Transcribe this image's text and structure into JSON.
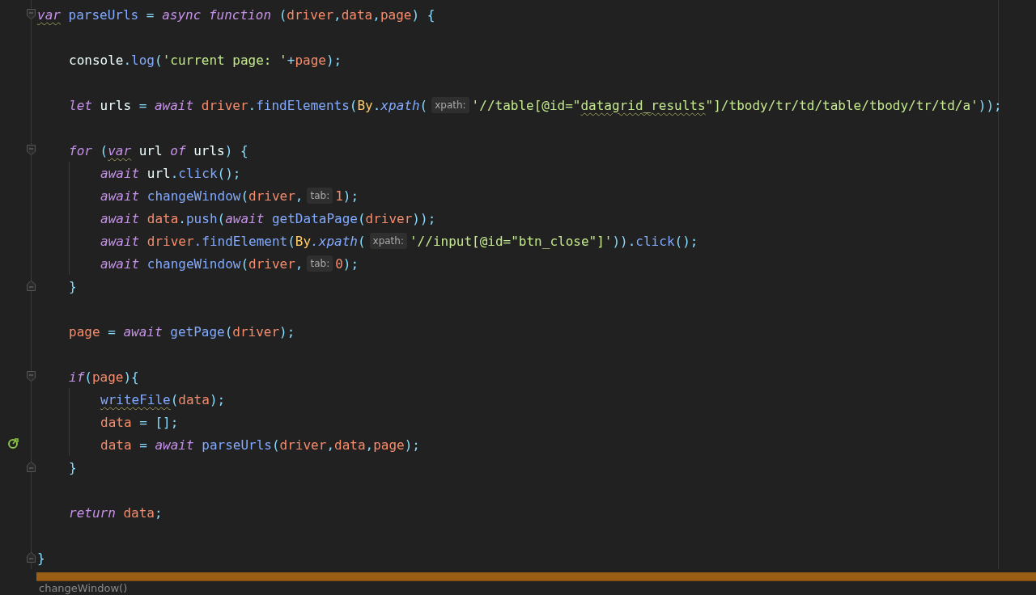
{
  "editor": {
    "lines": [
      {
        "kind": "code",
        "fold_start": true,
        "tokens": [
          {
            "kind": "kw",
            "text": "var",
            "warning": true
          },
          {
            "kind": "fn",
            "text": " parseUrls"
          },
          {
            "kind": "op",
            "text": " = "
          },
          {
            "kind": "kw",
            "text": "async"
          },
          {
            "kind": "kw",
            "text": " function"
          },
          {
            "kind": "op",
            "text": " ("
          },
          {
            "kind": "var",
            "text": "driver"
          },
          {
            "kind": "op",
            "text": ","
          },
          {
            "kind": "var",
            "text": "data"
          },
          {
            "kind": "op",
            "text": ","
          },
          {
            "kind": "var",
            "text": "page"
          },
          {
            "kind": "op",
            "text": ") {"
          }
        ],
        "children": [
          {
            "kind": "blank"
          },
          {
            "kind": "code",
            "tokens": [
              {
                "kind": "plain",
                "text": "console"
              },
              {
                "kind": "op",
                "text": "."
              },
              {
                "kind": "fn",
                "text": "log"
              },
              {
                "kind": "op",
                "text": "("
              },
              {
                "kind": "str",
                "text": "'current page: '"
              },
              {
                "kind": "op",
                "text": "+"
              },
              {
                "kind": "var",
                "text": "page"
              },
              {
                "kind": "op",
                "text": ");"
              }
            ]
          },
          {
            "kind": "blank"
          },
          {
            "kind": "code",
            "tokens": [
              {
                "kind": "kw",
                "text": "let"
              },
              {
                "kind": "plain",
                "text": " urls "
              },
              {
                "kind": "op",
                "text": "= "
              },
              {
                "kind": "kw",
                "text": "await"
              },
              {
                "kind": "var",
                "text": " driver"
              },
              {
                "kind": "op",
                "text": "."
              },
              {
                "kind": "fn",
                "text": "findElements"
              },
              {
                "kind": "op",
                "text": "("
              },
              {
                "kind": "cls",
                "text": "By"
              },
              {
                "kind": "op",
                "text": "."
              },
              {
                "kind": "method",
                "text": "xpath"
              },
              {
                "kind": "op",
                "text": "("
              },
              {
                "kind": "hint",
                "text": "xpath:"
              },
              {
                "kind": "str",
                "text": "'//table[@id=\""
              },
              {
                "kind": "str",
                "text": "datagrid_results",
                "warning": true
              },
              {
                "kind": "str",
                "text": "\"]/tbody/tr/td/table/tbody/tr/td/a'"
              },
              {
                "kind": "op",
                "text": "));"
              }
            ]
          },
          {
            "kind": "blank"
          },
          {
            "kind": "code",
            "fold_start": true,
            "tokens": [
              {
                "kind": "kw",
                "text": "for"
              },
              {
                "kind": "op",
                "text": " ("
              },
              {
                "kind": "kw",
                "text": "var",
                "warning": true
              },
              {
                "kind": "plain",
                "text": " url "
              },
              {
                "kind": "kw",
                "text": "of"
              },
              {
                "kind": "plain",
                "text": " urls"
              },
              {
                "kind": "op",
                "text": ") {"
              }
            ],
            "children": [
              {
                "kind": "code",
                "tokens": [
                  {
                    "kind": "kw",
                    "text": "await"
                  },
                  {
                    "kind": "plain",
                    "text": " url"
                  },
                  {
                    "kind": "op",
                    "text": "."
                  },
                  {
                    "kind": "fn",
                    "text": "click"
                  },
                  {
                    "kind": "op",
                    "text": "();"
                  }
                ]
              },
              {
                "kind": "code",
                "tokens": [
                  {
                    "kind": "kw",
                    "text": "await"
                  },
                  {
                    "kind": "fn",
                    "text": " changeWindow"
                  },
                  {
                    "kind": "op",
                    "text": "("
                  },
                  {
                    "kind": "var",
                    "text": "driver"
                  },
                  {
                    "kind": "op",
                    "text": ","
                  },
                  {
                    "kind": "hint",
                    "text": "tab:"
                  },
                  {
                    "kind": "num",
                    "text": "1"
                  },
                  {
                    "kind": "op",
                    "text": ");"
                  }
                ]
              },
              {
                "kind": "code",
                "tokens": [
                  {
                    "kind": "kw",
                    "text": "await"
                  },
                  {
                    "kind": "var",
                    "text": " data"
                  },
                  {
                    "kind": "op",
                    "text": "."
                  },
                  {
                    "kind": "fn",
                    "text": "push"
                  },
                  {
                    "kind": "op",
                    "text": "("
                  },
                  {
                    "kind": "kw",
                    "text": "await"
                  },
                  {
                    "kind": "fn",
                    "text": " getDataPage"
                  },
                  {
                    "kind": "op",
                    "text": "("
                  },
                  {
                    "kind": "var",
                    "text": "driver"
                  },
                  {
                    "kind": "op",
                    "text": "));"
                  }
                ]
              },
              {
                "kind": "code",
                "tokens": [
                  {
                    "kind": "kw",
                    "text": "await"
                  },
                  {
                    "kind": "var",
                    "text": " driver"
                  },
                  {
                    "kind": "fn",
                    "text": ".findElement"
                  },
                  {
                    "kind": "op",
                    "text": "("
                  },
                  {
                    "kind": "cls",
                    "text": "By"
                  },
                  {
                    "kind": "method",
                    "text": ".xpath"
                  },
                  {
                    "kind": "op",
                    "text": "("
                  },
                  {
                    "kind": "hint",
                    "text": "xpath:"
                  },
                  {
                    "kind": "str",
                    "text": "'//input[@id=\"btn_close\"]'"
                  },
                  {
                    "kind": "op",
                    "text": "))."
                  },
                  {
                    "kind": "fn",
                    "text": "click"
                  },
                  {
                    "kind": "op",
                    "text": "();"
                  }
                ]
              },
              {
                "kind": "code",
                "tokens": [
                  {
                    "kind": "kw",
                    "text": "await"
                  },
                  {
                    "kind": "fn",
                    "text": " changeWindow"
                  },
                  {
                    "kind": "op",
                    "text": "("
                  },
                  {
                    "kind": "var",
                    "text": "driver"
                  },
                  {
                    "kind": "op",
                    "text": ","
                  },
                  {
                    "kind": "hint",
                    "text": "tab:"
                  },
                  {
                    "kind": "num",
                    "text": "0"
                  },
                  {
                    "kind": "op",
                    "text": ");"
                  }
                ]
              }
            ]
          },
          {
            "kind": "code",
            "fold_end": true,
            "tokens": [
              {
                "kind": "op",
                "text": "}"
              }
            ]
          },
          {
            "kind": "blank"
          },
          {
            "kind": "code",
            "tokens": [
              {
                "kind": "var",
                "text": "page"
              },
              {
                "kind": "op",
                "text": " = "
              },
              {
                "kind": "kw",
                "text": "await"
              },
              {
                "kind": "fn",
                "text": " getPage"
              },
              {
                "kind": "op",
                "text": "("
              },
              {
                "kind": "var",
                "text": "driver"
              },
              {
                "kind": "op",
                "text": ");"
              }
            ]
          },
          {
            "kind": "blank"
          },
          {
            "kind": "code",
            "fold_start": true,
            "tokens": [
              {
                "kind": "kw",
                "text": "if"
              },
              {
                "kind": "op",
                "text": "("
              },
              {
                "kind": "var",
                "text": "page"
              },
              {
                "kind": "op",
                "text": "){"
              }
            ],
            "children": [
              {
                "kind": "code",
                "tokens": [
                  {
                    "kind": "fn",
                    "text": "writeFile",
                    "warning": true
                  },
                  {
                    "kind": "op",
                    "text": "("
                  },
                  {
                    "kind": "var",
                    "text": "data"
                  },
                  {
                    "kind": "op",
                    "text": ");"
                  }
                ]
              },
              {
                "kind": "code",
                "tokens": [
                  {
                    "kind": "var",
                    "text": "data"
                  },
                  {
                    "kind": "op",
                    "text": " = [];"
                  }
                ]
              },
              {
                "kind": "code",
                "recursive_call": true,
                "tokens": [
                  {
                    "kind": "var",
                    "text": "data"
                  },
                  {
                    "kind": "op",
                    "text": " = "
                  },
                  {
                    "kind": "kw",
                    "text": "await"
                  },
                  {
                    "kind": "fn",
                    "text": " parseUrls"
                  },
                  {
                    "kind": "op",
                    "text": "("
                  },
                  {
                    "kind": "var",
                    "text": "driver"
                  },
                  {
                    "kind": "op",
                    "text": ","
                  },
                  {
                    "kind": "var",
                    "text": "data"
                  },
                  {
                    "kind": "op",
                    "text": ","
                  },
                  {
                    "kind": "var",
                    "text": "page"
                  },
                  {
                    "kind": "op",
                    "text": ");"
                  }
                ]
              }
            ]
          },
          {
            "kind": "code",
            "fold_end": true,
            "tokens": [
              {
                "kind": "op",
                "text": "}"
              }
            ]
          },
          {
            "kind": "blank"
          },
          {
            "kind": "code",
            "tokens": [
              {
                "kind": "kw",
                "text": "return"
              },
              {
                "kind": "var",
                "text": " data"
              },
              {
                "kind": "op",
                "text": ";"
              }
            ]
          },
          {
            "kind": "blank"
          }
        ]
      },
      {
        "kind": "code",
        "fold_end": true,
        "tokens": [
          {
            "kind": "op",
            "text": "}"
          }
        ]
      }
    ]
  },
  "status_bar": {
    "text": "changeWindow()"
  }
}
